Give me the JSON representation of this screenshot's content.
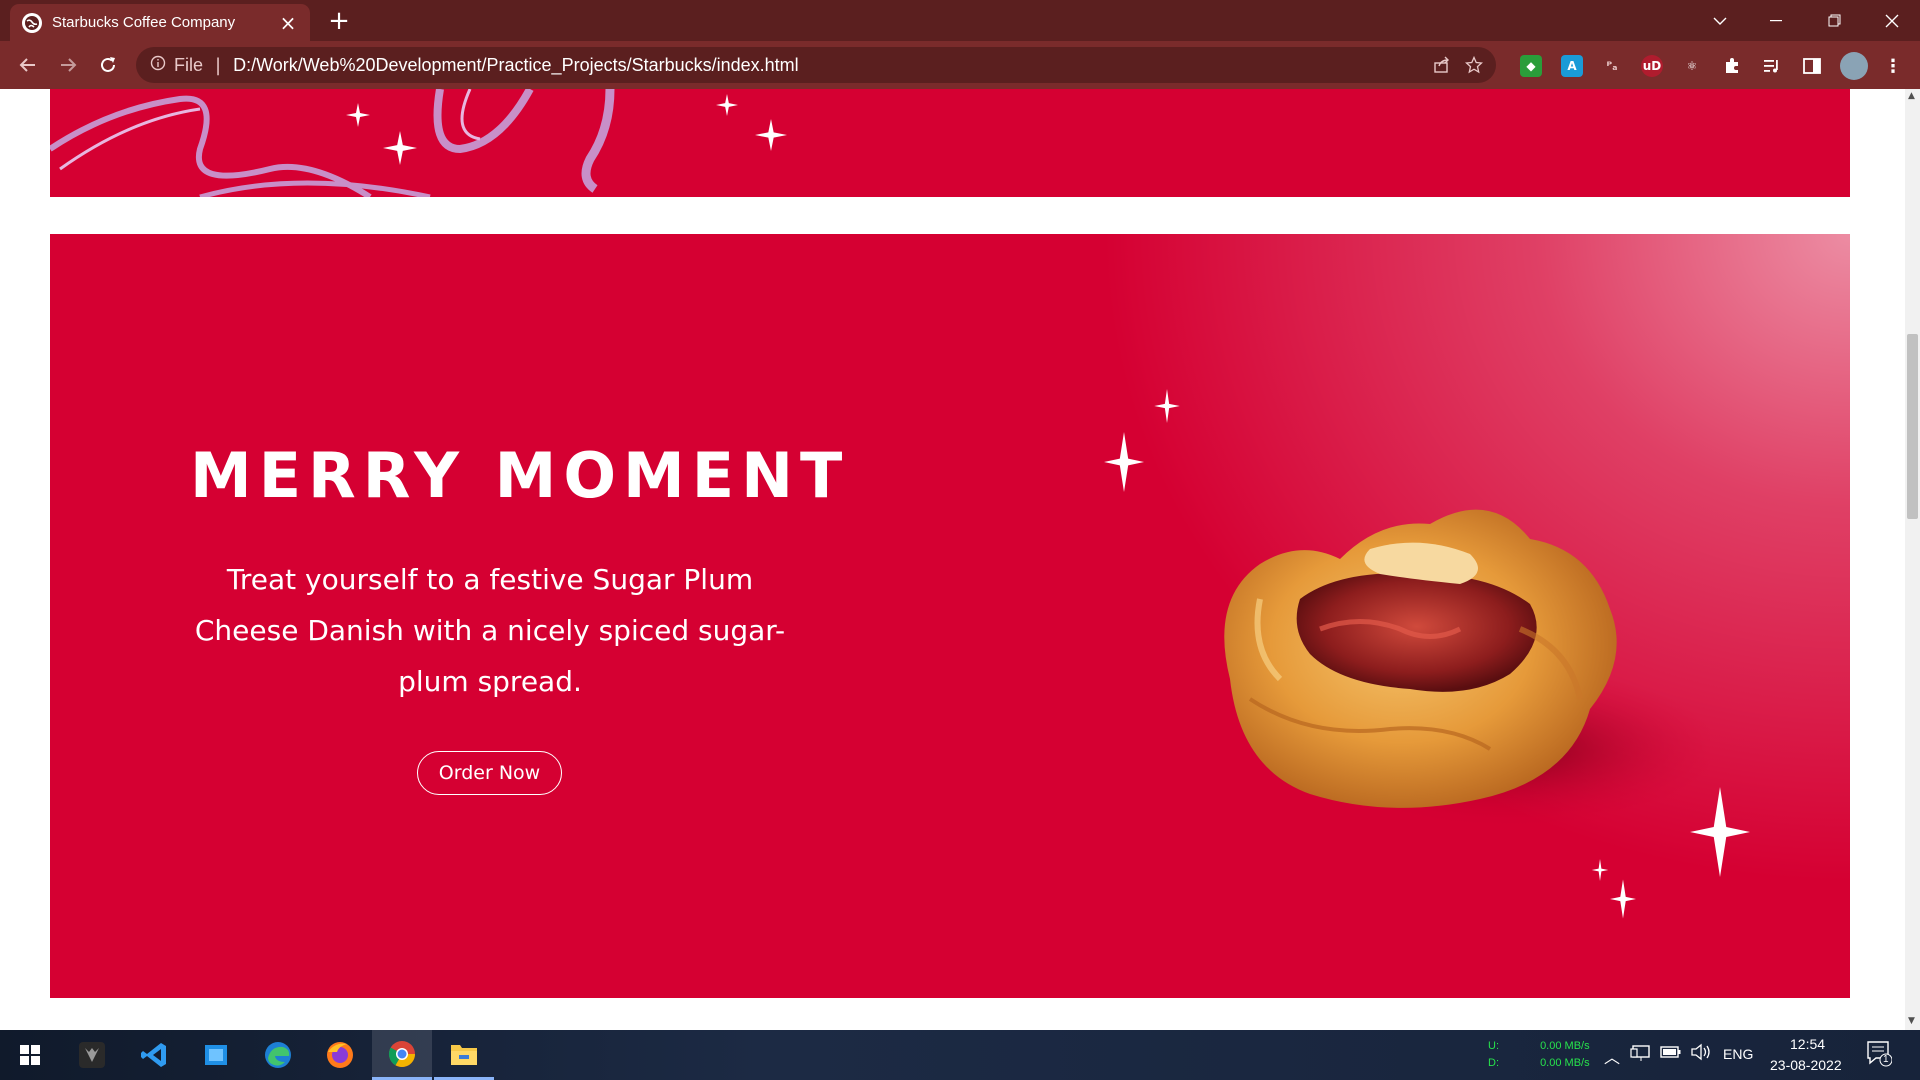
{
  "browser": {
    "tab_title": "Starbucks Coffee Company",
    "url_scheme": "File",
    "url": "D:/Work/Web%20Development/Practice_Projects/Starbucks/index.html"
  },
  "banner": {
    "headline": "MERRY MOMENT",
    "description": "Treat yourself to a festive Sugar Plum Cheese Danish with a nicely spiced sugar-plum spread.",
    "cta_label": "Order Now",
    "background_color": "#d50032"
  },
  "taskbar": {
    "net_up_label": "U:",
    "net_down_label": "D:",
    "net_up_value": "0.00 MB/s",
    "net_down_value": "0.00 MB/s",
    "language": "ENG",
    "time": "12:54",
    "date": "23-08-2022",
    "notification_count": "1",
    "apps": [
      "windows-start",
      "predator",
      "vscode",
      "file-manager",
      "edge",
      "firefox",
      "chrome",
      "explorer"
    ]
  }
}
